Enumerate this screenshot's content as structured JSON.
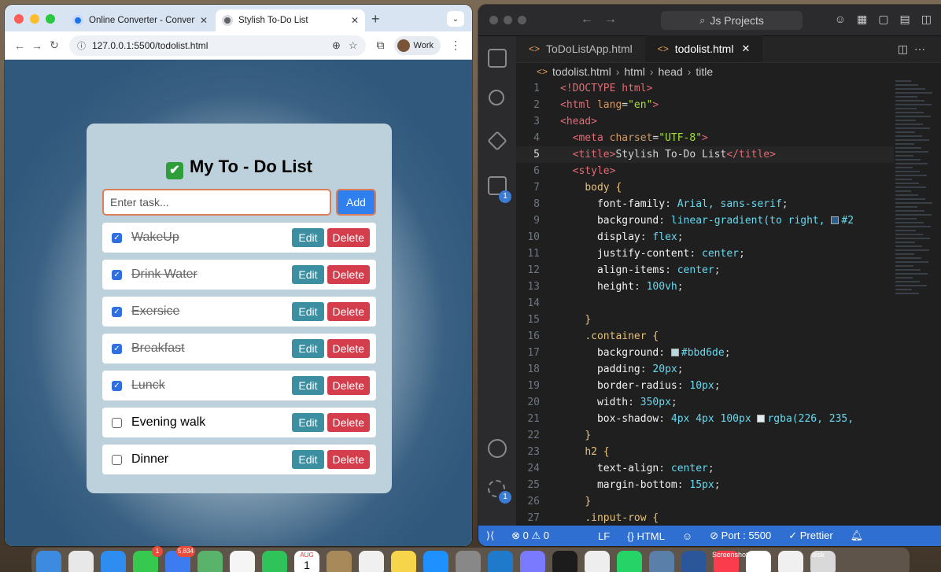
{
  "chrome": {
    "tabs": [
      {
        "label": "Online Converter - Convert Im",
        "active": false
      },
      {
        "label": "Stylish To-Do List",
        "active": true
      }
    ],
    "new_tab": "+",
    "url": "127.0.0.1:5500/todolist.html",
    "profile": "Work"
  },
  "todo": {
    "title": "My To - Do List",
    "title_icon": "✔",
    "input_placeholder": "Enter task...",
    "add_label": "Add",
    "edit_label": "Edit",
    "delete_label": "Delete",
    "tasks": [
      {
        "text": "WakeUp",
        "done": true
      },
      {
        "text": "Drink Water",
        "done": true
      },
      {
        "text": "Exersice",
        "done": true
      },
      {
        "text": "Breakfast",
        "done": true
      },
      {
        "text": "Lunck",
        "done": true
      },
      {
        "text": "Evening walk",
        "done": false
      },
      {
        "text": "Dinner",
        "done": false
      }
    ]
  },
  "vscode": {
    "search": "Js Projects",
    "tabs": [
      {
        "label": "ToDoListApp.html",
        "active": false
      },
      {
        "label": "todolist.html",
        "active": true
      }
    ],
    "breadcrumbs": [
      "todolist.html",
      "html",
      "head",
      "title"
    ],
    "extensions_badge": "1",
    "settings_badge": "1",
    "code_lines": [
      {
        "n": "1",
        "html": "<span class='tag'>&lt;!DOCTYPE html&gt;</span>"
      },
      {
        "n": "2",
        "html": "<span class='tag'>&lt;html</span> <span class='attr'>lang</span>=<span class='str'>\"en\"</span><span class='tag'>&gt;</span>"
      },
      {
        "n": "3",
        "html": "<span class='tag'>&lt;head&gt;</span>"
      },
      {
        "n": "4",
        "html": "  <span class='tag'>&lt;meta</span> <span class='attr'>charset</span>=<span class='str'>\"UTF-8\"</span><span class='tag'>&gt;</span>"
      },
      {
        "n": "5",
        "html": "  <span class='tag'>&lt;title&gt;</span>Stylish To-Do List<span class='tag'>&lt;/title&gt;</span>",
        "current": true
      },
      {
        "n": "6",
        "html": "  <span class='tag'>&lt;style&gt;</span>"
      },
      {
        "n": "7",
        "html": "    <span class='sel'>body</span> <span class='punc'>{</span>"
      },
      {
        "n": "8",
        "html": "      <span class='prop'>font-family</span>: <span class='val'>Arial, sans-serif</span>;"
      },
      {
        "n": "9",
        "html": "      <span class='prop'>background</span>: <span class='val'>linear-gradient(to right, </span><span class='swatch' style='background:#2c5d8a'></span><span class='val'>#2</span>"
      },
      {
        "n": "10",
        "html": "      <span class='prop'>display</span>: <span class='val'>flex</span>;"
      },
      {
        "n": "11",
        "html": "      <span class='prop'>justify-content</span>: <span class='val'>center</span>;"
      },
      {
        "n": "12",
        "html": "      <span class='prop'>align-items</span>: <span class='val'>center</span>;"
      },
      {
        "n": "13",
        "html": "      <span class='prop'>height</span>: <span class='val'>100vh</span>;"
      },
      {
        "n": "14",
        "html": ""
      },
      {
        "n": "15",
        "html": "    <span class='punc'>}</span>"
      },
      {
        "n": "16",
        "html": "    <span class='sel'>.container</span> <span class='punc'>{</span>"
      },
      {
        "n": "17",
        "html": "      <span class='prop'>background</span>: <span class='swatch' style='background:#bbd6de'></span><span class='val'>#bbd6de</span>;"
      },
      {
        "n": "18",
        "html": "      <span class='prop'>padding</span>: <span class='val'>20px</span>;"
      },
      {
        "n": "19",
        "html": "      <span class='prop'>border-radius</span>: <span class='val'>10px</span>;"
      },
      {
        "n": "20",
        "html": "      <span class='prop'>width</span>: <span class='val'>350px</span>;"
      },
      {
        "n": "21",
        "html": "      <span class='prop'>box-shadow</span>: <span class='val'>4px 4px 100px </span><span class='swatch' style='background:#e2ebef'></span><span class='val'>rgba(226, 235,</span>"
      },
      {
        "n": "22",
        "html": "    <span class='punc'>}</span>"
      },
      {
        "n": "23",
        "html": "    <span class='sel'>h2</span> <span class='punc'>{</span>"
      },
      {
        "n": "24",
        "html": "      <span class='prop'>text-align</span>: <span class='val'>center</span>;"
      },
      {
        "n": "25",
        "html": "      <span class='prop'>margin-bottom</span>: <span class='val'>15px</span>;"
      },
      {
        "n": "26",
        "html": "    <span class='punc'>}</span>"
      },
      {
        "n": "27",
        "html": "    <span class='sel'>.input-row</span> <span class='punc'>{</span>"
      }
    ],
    "status": {
      "errors": "⊗ 0 ⚠ 0",
      "eol": "LF",
      "language": "{} HTML",
      "port": "⊘ Port : 5500",
      "prettier": "✓ Prettier"
    }
  },
  "dock": {
    "captions": [
      "Screenshot",
      "disk"
    ],
    "badges": [
      "1",
      "5,834"
    ],
    "calendar_month": "AUG",
    "calendar_day": "1"
  }
}
